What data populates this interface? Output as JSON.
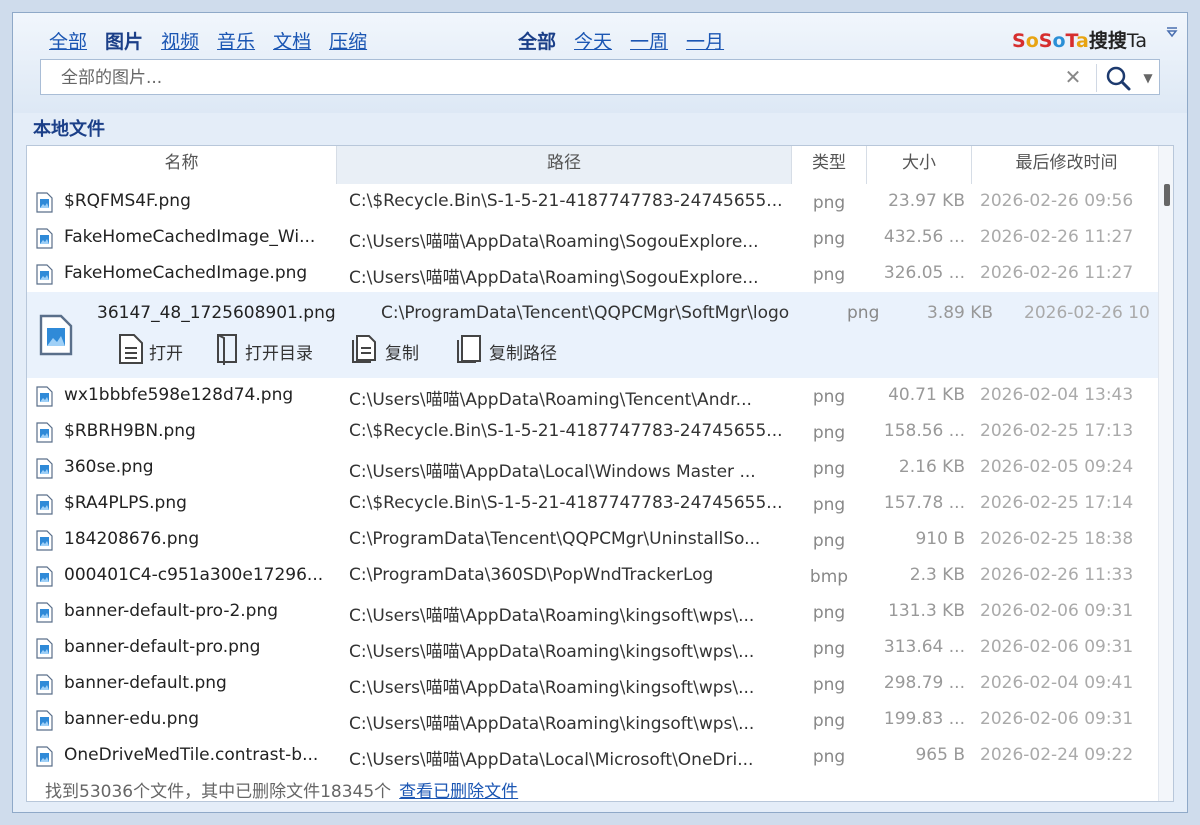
{
  "filters": {
    "categories": [
      {
        "label": "全部",
        "active": false
      },
      {
        "label": "图片",
        "active": true
      },
      {
        "label": "视频",
        "active": false
      },
      {
        "label": "音乐",
        "active": false
      },
      {
        "label": "文档",
        "active": false
      },
      {
        "label": "压缩",
        "active": false
      }
    ],
    "time": [
      {
        "label": "全部",
        "active": true
      },
      {
        "label": "今天",
        "active": false
      },
      {
        "label": "一周",
        "active": false
      },
      {
        "label": "一月",
        "active": false
      }
    ]
  },
  "brand": {
    "logo_text": "SoSoTa",
    "name": "搜搜",
    "suffix": "Ta"
  },
  "search": {
    "placeholder": "全部的图片..."
  },
  "section_title": "本地文件",
  "table": {
    "headers": {
      "name": "名称",
      "path": "路径",
      "type": "类型",
      "size": "大小",
      "modified": "最后修改时间"
    },
    "rows": [
      {
        "name": "$RQFMS4F.png",
        "path": "C:\\$Recycle.Bin\\S-1-5-21-4187747783-24745655...",
        "type": "png",
        "size": "23.97 KB",
        "modified": "2026-02-26 09:56"
      },
      {
        "name": "FakeHomeCachedImage_Wi...",
        "path": "C:\\Users\\喵喵\\AppData\\Roaming\\SogouExplore...",
        "type": "png",
        "size": "432.56 ...",
        "modified": "2026-02-26 11:27"
      },
      {
        "name": "FakeHomeCachedImage.png",
        "path": "C:\\Users\\喵喵\\AppData\\Roaming\\SogouExplore...",
        "type": "png",
        "size": "326.05 ...",
        "modified": "2026-02-26 11:27"
      },
      {
        "name": "36147_48_1725608901.png",
        "path": "C:\\ProgramData\\Tencent\\QQPCMgr\\SoftMgr\\logo",
        "type": "png",
        "size": "3.89 KB",
        "modified": "2026-02-26 10",
        "expanded": true
      },
      {
        "name": "wx1bbbfe598e128d74.png",
        "path": "C:\\Users\\喵喵\\AppData\\Roaming\\Tencent\\Andr...",
        "type": "png",
        "size": "40.71 KB",
        "modified": "2026-02-04 13:43"
      },
      {
        "name": "$RBRH9BN.png",
        "path": "C:\\$Recycle.Bin\\S-1-5-21-4187747783-24745655...",
        "type": "png",
        "size": "158.56 ...",
        "modified": "2026-02-25 17:13"
      },
      {
        "name": "360se.png",
        "path": "C:\\Users\\喵喵\\AppData\\Local\\Windows Master ...",
        "type": "png",
        "size": "2.16 KB",
        "modified": "2026-02-05 09:24"
      },
      {
        "name": "$RA4PLPS.png",
        "path": "C:\\$Recycle.Bin\\S-1-5-21-4187747783-24745655...",
        "type": "png",
        "size": "157.78 ...",
        "modified": "2026-02-25 17:14"
      },
      {
        "name": "184208676.png",
        "path": "C:\\ProgramData\\Tencent\\QQPCMgr\\UninstallSo...",
        "type": "png",
        "size": "910 B",
        "modified": "2026-02-25 18:38"
      },
      {
        "name": "000401C4-c951a300e17296...",
        "path": "C:\\ProgramData\\360SD\\PopWndTrackerLog",
        "type": "bmp",
        "size": "2.3 KB",
        "modified": "2026-02-26 11:33"
      },
      {
        "name": "banner-default-pro-2.png",
        "path": "C:\\Users\\喵喵\\AppData\\Roaming\\kingsoft\\wps\\...",
        "type": "png",
        "size": "131.3 KB",
        "modified": "2026-02-06 09:31"
      },
      {
        "name": "banner-default-pro.png",
        "path": "C:\\Users\\喵喵\\AppData\\Roaming\\kingsoft\\wps\\...",
        "type": "png",
        "size": "313.64 ...",
        "modified": "2026-02-06 09:31"
      },
      {
        "name": "banner-default.png",
        "path": "C:\\Users\\喵喵\\AppData\\Roaming\\kingsoft\\wps\\...",
        "type": "png",
        "size": "298.79 ...",
        "modified": "2026-02-04 09:41"
      },
      {
        "name": "banner-edu.png",
        "path": "C:\\Users\\喵喵\\AppData\\Roaming\\kingsoft\\wps\\...",
        "type": "png",
        "size": "199.83 ...",
        "modified": "2026-02-06 09:31"
      },
      {
        "name": "OneDriveMedTile.contrast-b...",
        "path": "C:\\Users\\喵喵\\AppData\\Local\\Microsoft\\OneDri...",
        "type": "png",
        "size": "965 B",
        "modified": "2026-02-24 09:22"
      }
    ],
    "row_actions": [
      {
        "label": "打开",
        "icon": "document-icon"
      },
      {
        "label": "打开目录",
        "icon": "folder-icon"
      },
      {
        "label": "复制",
        "icon": "copy-icon"
      },
      {
        "label": "复制路径",
        "icon": "copy-path-icon"
      }
    ]
  },
  "status": {
    "summary": "找到53036个文件，其中已删除文件18345个",
    "link": "查看已删除文件"
  }
}
